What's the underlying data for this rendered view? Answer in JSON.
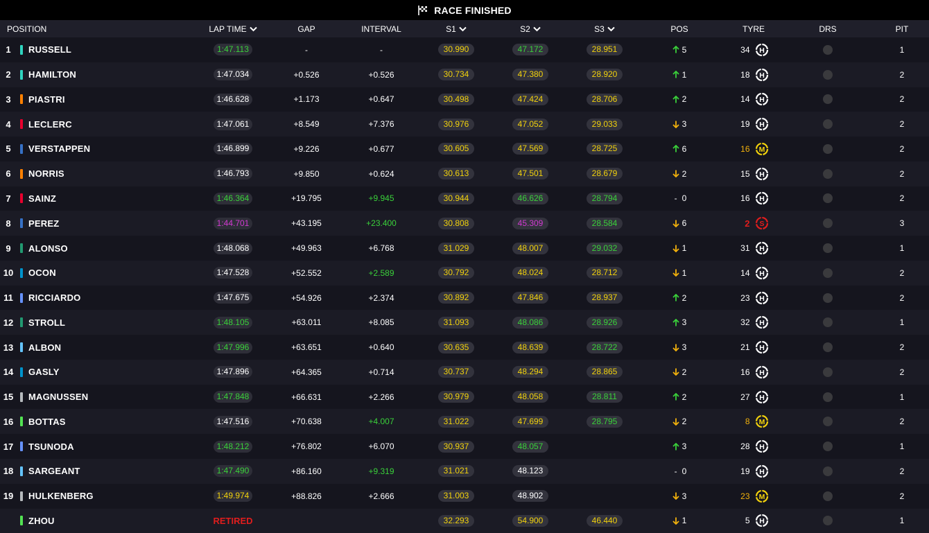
{
  "title": "RACE FINISHED",
  "headers": {
    "position": "POSITION",
    "lap_time": "LAP TIME",
    "gap": "GAP",
    "interval": "INTERVAL",
    "s1": "S1",
    "s2": "S2",
    "s3": "S3",
    "pos": "POS",
    "tyre": "TYRE",
    "drs": "DRS",
    "pit": "PIT"
  },
  "colors": {
    "green": "#3ad13a",
    "purple": "#d23ad2",
    "yellow": "#f2d20c",
    "white": "#ffffff",
    "red": "#e01d1d",
    "orange": "#f2b10c"
  },
  "rows": [
    {
      "pos": "1",
      "team": "#2fd4bf",
      "driver": "RUSSELL",
      "lap": "1:47.113",
      "lapc": "green",
      "gap": "-",
      "int": "-",
      "intc": "white",
      "s1": "30.990",
      "s1c": "yellow",
      "s2": "47.172",
      "s2c": "green",
      "s3": "28.951",
      "s3c": "yellow",
      "dir": "up",
      "delta": "5",
      "tyre_laps": "34",
      "tyre": "H",
      "tyrec": "white",
      "pit": "1"
    },
    {
      "pos": "2",
      "team": "#2fd4bf",
      "driver": "HAMILTON",
      "lap": "1:47.034",
      "lapc": "white",
      "gap": "+0.526",
      "int": "+0.526",
      "intc": "white",
      "s1": "30.734",
      "s1c": "yellow",
      "s2": "47.380",
      "s2c": "yellow",
      "s3": "28.920",
      "s3c": "yellow",
      "dir": "up",
      "delta": "1",
      "tyre_laps": "18",
      "tyre": "H",
      "tyrec": "white",
      "pit": "2"
    },
    {
      "pos": "3",
      "team": "#ff8000",
      "driver": "PIASTRI",
      "lap": "1:46.628",
      "lapc": "white",
      "gap": "+1.173",
      "int": "+0.647",
      "intc": "white",
      "s1": "30.498",
      "s1c": "yellow",
      "s2": "47.424",
      "s2c": "yellow",
      "s3": "28.706",
      "s3c": "yellow",
      "dir": "up",
      "delta": "2",
      "tyre_laps": "14",
      "tyre": "H",
      "tyrec": "white",
      "pit": "2"
    },
    {
      "pos": "4",
      "team": "#e8002d",
      "driver": "LECLERC",
      "lap": "1:47.061",
      "lapc": "white",
      "gap": "+8.549",
      "int": "+7.376",
      "intc": "white",
      "s1": "30.976",
      "s1c": "yellow",
      "s2": "47.052",
      "s2c": "yellow",
      "s3": "29.033",
      "s3c": "yellow",
      "dir": "down",
      "delta": "3",
      "tyre_laps": "19",
      "tyre": "H",
      "tyrec": "white",
      "pit": "2"
    },
    {
      "pos": "5",
      "team": "#3671c6",
      "driver": "VERSTAPPEN",
      "lap": "1:46.899",
      "lapc": "white",
      "gap": "+9.226",
      "int": "+0.677",
      "intc": "white",
      "s1": "30.605",
      "s1c": "yellow",
      "s2": "47.569",
      "s2c": "yellow",
      "s3": "28.725",
      "s3c": "yellow",
      "dir": "up",
      "delta": "6",
      "tyre_laps": "16",
      "tyre": "M",
      "tyrec": "orange",
      "pit": "2"
    },
    {
      "pos": "6",
      "team": "#ff8000",
      "driver": "NORRIS",
      "lap": "1:46.793",
      "lapc": "white",
      "gap": "+9.850",
      "int": "+0.624",
      "intc": "white",
      "s1": "30.613",
      "s1c": "yellow",
      "s2": "47.501",
      "s2c": "yellow",
      "s3": "28.679",
      "s3c": "yellow",
      "dir": "down",
      "delta": "2",
      "tyre_laps": "15",
      "tyre": "H",
      "tyrec": "white",
      "pit": "2"
    },
    {
      "pos": "7",
      "team": "#e8002d",
      "driver": "SAINZ",
      "lap": "1:46.364",
      "lapc": "green",
      "gap": "+19.795",
      "int": "+9.945",
      "intc": "green",
      "s1": "30.944",
      "s1c": "yellow",
      "s2": "46.626",
      "s2c": "green",
      "s3": "28.794",
      "s3c": "green",
      "dir": "none",
      "delta": "0",
      "tyre_laps": "16",
      "tyre": "H",
      "tyrec": "white",
      "pit": "2"
    },
    {
      "pos": "8",
      "team": "#3671c6",
      "driver": "PEREZ",
      "lap": "1:44.701",
      "lapc": "purple",
      "gap": "+43.195",
      "int": "+23.400",
      "intc": "green",
      "s1": "30.808",
      "s1c": "yellow",
      "s2": "45.309",
      "s2c": "purple",
      "s3": "28.584",
      "s3c": "green",
      "dir": "down",
      "delta": "6",
      "tyre_laps": "2",
      "tyre": "S",
      "tyrec": "red",
      "pit": "3"
    },
    {
      "pos": "9",
      "team": "#229971",
      "driver": "ALONSO",
      "lap": "1:48.068",
      "lapc": "white",
      "gap": "+49.963",
      "int": "+6.768",
      "intc": "white",
      "s1": "31.029",
      "s1c": "yellow",
      "s2": "48.007",
      "s2c": "yellow",
      "s3": "29.032",
      "s3c": "green",
      "dir": "down",
      "delta": "1",
      "tyre_laps": "31",
      "tyre": "H",
      "tyrec": "white",
      "pit": "1"
    },
    {
      "pos": "10",
      "team": "#0093cc",
      "driver": "OCON",
      "lap": "1:47.528",
      "lapc": "white",
      "gap": "+52.552",
      "int": "+2.589",
      "intc": "green",
      "s1": "30.792",
      "s1c": "yellow",
      "s2": "48.024",
      "s2c": "yellow",
      "s3": "28.712",
      "s3c": "yellow",
      "dir": "down",
      "delta": "1",
      "tyre_laps": "14",
      "tyre": "H",
      "tyrec": "white",
      "pit": "2"
    },
    {
      "pos": "11",
      "team": "#6692ff",
      "driver": "RICCIARDO",
      "lap": "1:47.675",
      "lapc": "white",
      "gap": "+54.926",
      "int": "+2.374",
      "intc": "white",
      "s1": "30.892",
      "s1c": "yellow",
      "s2": "47.846",
      "s2c": "yellow",
      "s3": "28.937",
      "s3c": "yellow",
      "dir": "up",
      "delta": "2",
      "tyre_laps": "23",
      "tyre": "H",
      "tyrec": "white",
      "pit": "2"
    },
    {
      "pos": "12",
      "team": "#229971",
      "driver": "STROLL",
      "lap": "1:48.105",
      "lapc": "green",
      "gap": "+63.011",
      "int": "+8.085",
      "intc": "white",
      "s1": "31.093",
      "s1c": "yellow",
      "s2": "48.086",
      "s2c": "green",
      "s3": "28.926",
      "s3c": "green",
      "dir": "up",
      "delta": "3",
      "tyre_laps": "32",
      "tyre": "H",
      "tyrec": "white",
      "pit": "1"
    },
    {
      "pos": "13",
      "team": "#64c4ff",
      "driver": "ALBON",
      "lap": "1:47.996",
      "lapc": "green",
      "gap": "+63.651",
      "int": "+0.640",
      "intc": "white",
      "s1": "30.635",
      "s1c": "yellow",
      "s2": "48.639",
      "s2c": "yellow",
      "s3": "28.722",
      "s3c": "green",
      "dir": "down",
      "delta": "3",
      "tyre_laps": "21",
      "tyre": "H",
      "tyrec": "white",
      "pit": "2"
    },
    {
      "pos": "14",
      "team": "#0093cc",
      "driver": "GASLY",
      "lap": "1:47.896",
      "lapc": "white",
      "gap": "+64.365",
      "int": "+0.714",
      "intc": "white",
      "s1": "30.737",
      "s1c": "yellow",
      "s2": "48.294",
      "s2c": "yellow",
      "s3": "28.865",
      "s3c": "yellow",
      "dir": "down",
      "delta": "2",
      "tyre_laps": "16",
      "tyre": "H",
      "tyrec": "white",
      "pit": "2"
    },
    {
      "pos": "15",
      "team": "#b6babd",
      "driver": "MAGNUSSEN",
      "lap": "1:47.848",
      "lapc": "green",
      "gap": "+66.631",
      "int": "+2.266",
      "intc": "white",
      "s1": "30.979",
      "s1c": "yellow",
      "s2": "48.058",
      "s2c": "yellow",
      "s3": "28.811",
      "s3c": "green",
      "dir": "up",
      "delta": "2",
      "tyre_laps": "27",
      "tyre": "H",
      "tyrec": "white",
      "pit": "1"
    },
    {
      "pos": "16",
      "team": "#52e252",
      "driver": "BOTTAS",
      "lap": "1:47.516",
      "lapc": "white",
      "gap": "+70.638",
      "int": "+4.007",
      "intc": "green",
      "s1": "31.022",
      "s1c": "yellow",
      "s2": "47.699",
      "s2c": "yellow",
      "s3": "28.795",
      "s3c": "green",
      "dir": "down",
      "delta": "2",
      "tyre_laps": "8",
      "tyre": "M",
      "tyrec": "orange",
      "pit": "2"
    },
    {
      "pos": "17",
      "team": "#6692ff",
      "driver": "TSUNODA",
      "lap": "1:48.212",
      "lapc": "green",
      "gap": "+76.802",
      "int": "+6.070",
      "intc": "white",
      "s1": "30.937",
      "s1c": "yellow",
      "s2": "48.057",
      "s2c": "green",
      "s3": "",
      "s3c": "white",
      "dir": "up",
      "delta": "3",
      "tyre_laps": "28",
      "tyre": "H",
      "tyrec": "white",
      "pit": "1"
    },
    {
      "pos": "18",
      "team": "#64c4ff",
      "driver": "SARGEANT",
      "lap": "1:47.490",
      "lapc": "green",
      "gap": "+86.160",
      "int": "+9.319",
      "intc": "green",
      "s1": "31.021",
      "s1c": "yellow",
      "s2": "48.123",
      "s2c": "white",
      "s3": "",
      "s3c": "white",
      "dir": "none",
      "delta": "0",
      "tyre_laps": "19",
      "tyre": "H",
      "tyrec": "white",
      "pit": "2"
    },
    {
      "pos": "19",
      "team": "#b6babd",
      "driver": "HULKENBERG",
      "lap": "1:49.974",
      "lapc": "yellow",
      "gap": "+88.826",
      "int": "+2.666",
      "intc": "white",
      "s1": "31.003",
      "s1c": "yellow",
      "s2": "48.902",
      "s2c": "white",
      "s3": "",
      "s3c": "white",
      "dir": "down",
      "delta": "3",
      "tyre_laps": "23",
      "tyre": "M",
      "tyrec": "orange",
      "pit": "2"
    },
    {
      "pos": "",
      "team": "#52e252",
      "driver": "ZHOU",
      "lap": "RETIRED",
      "lapc": "red",
      "gap": "",
      "int": "",
      "intc": "white",
      "s1": "32.293",
      "s1c": "yellow",
      "s2": "54.900",
      "s2c": "yellow",
      "s3": "46.440",
      "s3c": "yellow",
      "dir": "down",
      "delta": "1",
      "tyre_laps": "5",
      "tyre": "H",
      "tyrec": "white",
      "pit": "1"
    }
  ]
}
